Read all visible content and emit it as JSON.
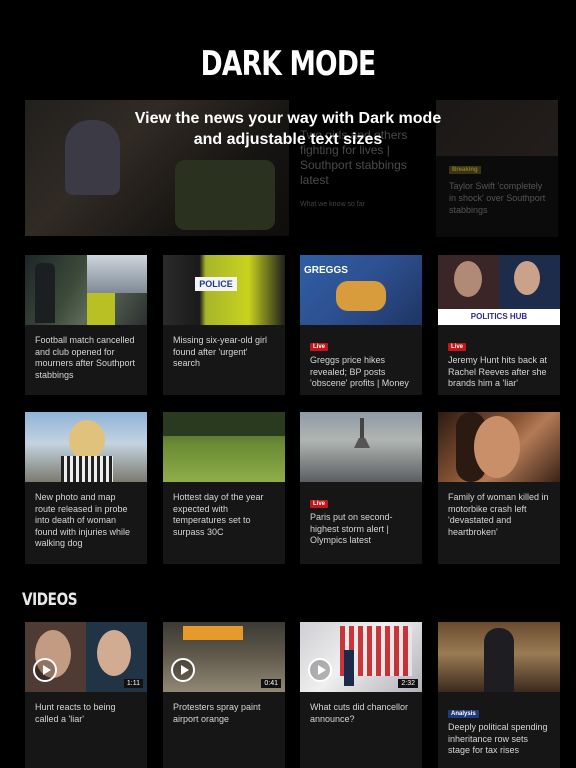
{
  "promo": {
    "title": "DARK MODE",
    "subtitle": "View the news your way with Dark mode and adjustable text sizes"
  },
  "lead": {
    "headline": "Two girls and others fighting for lives | Southport stabbings latest",
    "link": "What we know so far"
  },
  "side": {
    "badge": "Breaking",
    "text": "Taylor Swift 'completely in shock' over Southport stabbings"
  },
  "row1": [
    {
      "badge": "",
      "title": "Football match cancelled and club opened for mourners after Southport stabbings",
      "image": "police-scene-thumbnail"
    },
    {
      "badge": "",
      "title": "Missing six-year-old girl found after 'urgent' search",
      "image": "police-vest-thumbnail"
    },
    {
      "badge": "Live",
      "title": "Greggs price hikes revealed; BP posts 'obscene' profits | Money",
      "image": "greggs-thumbnail",
      "image_text": "GREGGS"
    },
    {
      "badge": "Live",
      "title": "Jeremy Hunt hits back at Rachel Reeves after she brands him a 'liar'",
      "image": "politics-hub-thumbnail",
      "image_text": "POLITICS HUB"
    }
  ],
  "row2": [
    {
      "badge": "",
      "title": "New photo and map route released in probe into death of woman found with injuries while walking dog",
      "image": "woman-portrait-thumbnail"
    },
    {
      "badge": "",
      "title": "Hottest day of the year expected with temperatures set to surpass 30C",
      "image": "park-sunbathers-thumbnail"
    },
    {
      "badge": "Live",
      "title": "Paris put on second-highest storm alert | Olympics latest",
      "image": "paris-storm-thumbnail"
    },
    {
      "badge": "",
      "title": "Family of woman killed in motorbike crash left 'devastated and heartbroken'",
      "image": "woman-face-thumbnail"
    }
  ],
  "videos": {
    "section_title": "VIDEOS",
    "items": [
      {
        "badge": "",
        "title": "Hunt reacts to being called a 'liar'",
        "duration": "1:11",
        "image": "hunt-reeves-thumbnail"
      },
      {
        "badge": "",
        "title": "Protesters spray paint airport orange",
        "duration": "0:41",
        "image": "airport-thumbnail"
      },
      {
        "badge": "",
        "title": "What cuts did chancellor announce?",
        "duration": "2:32",
        "image": "studio-thumbnail"
      },
      {
        "badge": "Analysis",
        "title": "Deeply political spending inheritance row sets stage for tax rises",
        "duration": "",
        "image": "chancellor-hall-thumbnail"
      }
    ]
  },
  "colors": {
    "background": "#000000",
    "card": "#161616",
    "live": "#c3161b",
    "analysis": "#1e3a78",
    "breaking": "#3a3412"
  }
}
